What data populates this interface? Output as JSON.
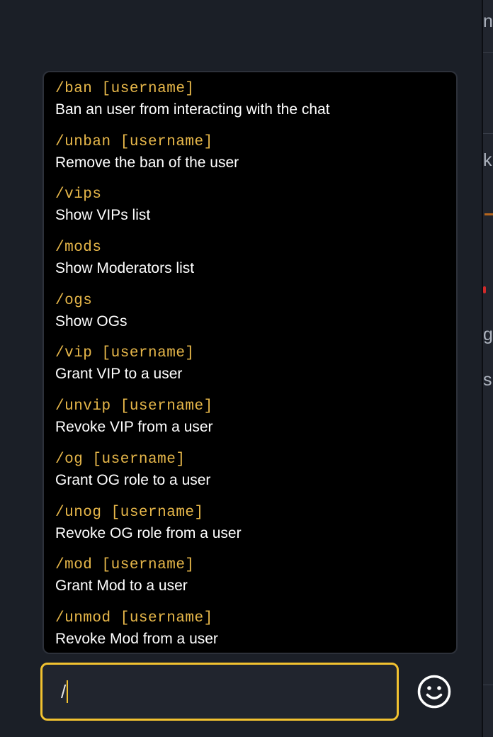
{
  "background_fragments": [
    "n",
    "k",
    "g",
    "s"
  ],
  "commands": [
    {
      "syntax": "/ban [username]",
      "description": "Ban an user from interacting with the chat"
    },
    {
      "syntax": "/unban [username]",
      "description": "Remove the ban of the user"
    },
    {
      "syntax": "/vips",
      "description": "Show VIPs list"
    },
    {
      "syntax": "/mods",
      "description": "Show Moderators list"
    },
    {
      "syntax": "/ogs",
      "description": "Show OGs"
    },
    {
      "syntax": "/vip [username]",
      "description": "Grant VIP to a user"
    },
    {
      "syntax": "/unvip [username]",
      "description": "Revoke VIP from a user"
    },
    {
      "syntax": "/og [username]",
      "description": "Grant OG role to a user"
    },
    {
      "syntax": "/unog [username]",
      "description": "Revoke OG role from a user"
    },
    {
      "syntax": "/mod [username]",
      "description": "Grant Mod to a user"
    },
    {
      "syntax": "/unmod [username]",
      "description": "Revoke Mod from a user"
    }
  ],
  "chat_input": {
    "value": "/"
  },
  "emoji_button": {
    "icon": "smiley-icon"
  },
  "colors": {
    "accent": "#f2c230",
    "command": "#e8b84a",
    "background": "#1b1f27",
    "popup": "#000000"
  }
}
